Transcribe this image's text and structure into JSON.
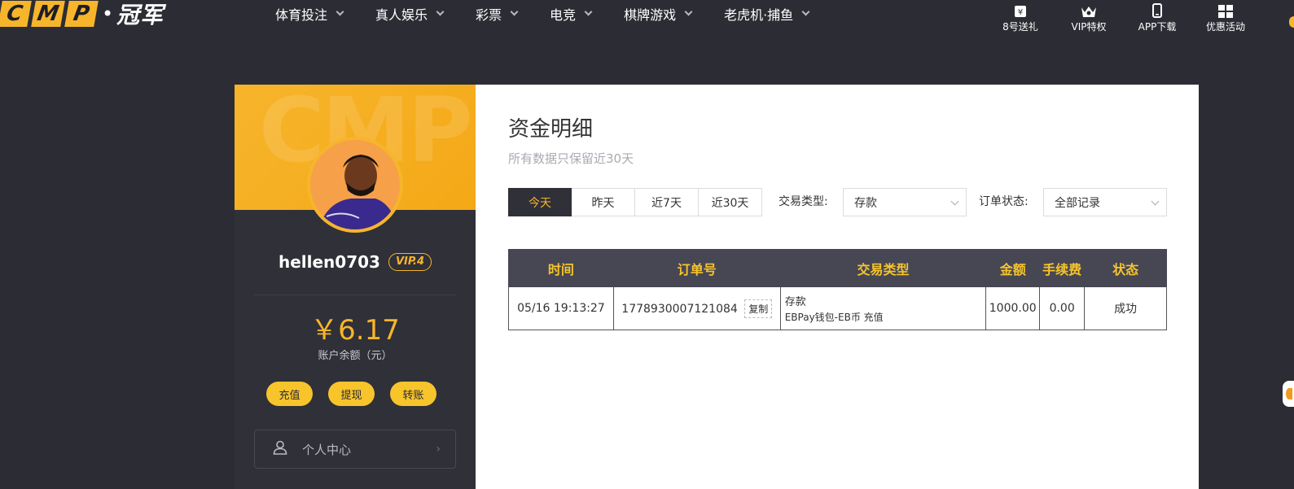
{
  "header": {
    "logo_letters": [
      "C",
      "M",
      "P"
    ],
    "logo_cn": "冠军",
    "nav": [
      {
        "label": "体育投注"
      },
      {
        "label": "真人娱乐"
      },
      {
        "label": "彩票"
      },
      {
        "label": "电竞"
      },
      {
        "label": "棋牌游戏"
      },
      {
        "label": "老虎机·捕鱼"
      }
    ],
    "quick_links": [
      {
        "label": "8号送礼",
        "icon": "gift-icon"
      },
      {
        "label": "VIP特权",
        "icon": "crown-icon"
      },
      {
        "label": "APP下载",
        "icon": "phone-icon"
      },
      {
        "label": "优惠活动",
        "icon": "grid-icon"
      }
    ]
  },
  "profile": {
    "watermark": "CMP",
    "username": "hellen0703",
    "vip": "VIP.4",
    "balance": "￥6.17",
    "balance_label": "账户余额（元）",
    "actions": [
      "充值",
      "提现",
      "转账"
    ],
    "menu_item": "个人中心"
  },
  "content": {
    "title": "资金明细",
    "subtitle": "所有数据只保留近30天",
    "date_tabs": [
      "今天",
      "昨天",
      "近7天",
      "近30天"
    ],
    "active_tab": "今天",
    "filter_type_label": "交易类型:",
    "filter_type_value": "存款",
    "filter_status_label": "订单状态:",
    "filter_status_value": "全部记录",
    "table": {
      "headers": [
        "时间",
        "订单号",
        "交易类型",
        "金额",
        "手续费",
        "状态"
      ],
      "rows": [
        {
          "time": "05/16 19:13:27",
          "order_no": "1778930007121084",
          "copy_label": "复制",
          "type_main": "存款",
          "type_sub": "EBPay钱包-EB币 充值",
          "amount": "1000.00",
          "fee": "0.00",
          "status": "成功"
        }
      ]
    }
  },
  "colors": {
    "accent": "#f7b52c",
    "background": "#2b2c34",
    "success": "#2e9e2e"
  }
}
